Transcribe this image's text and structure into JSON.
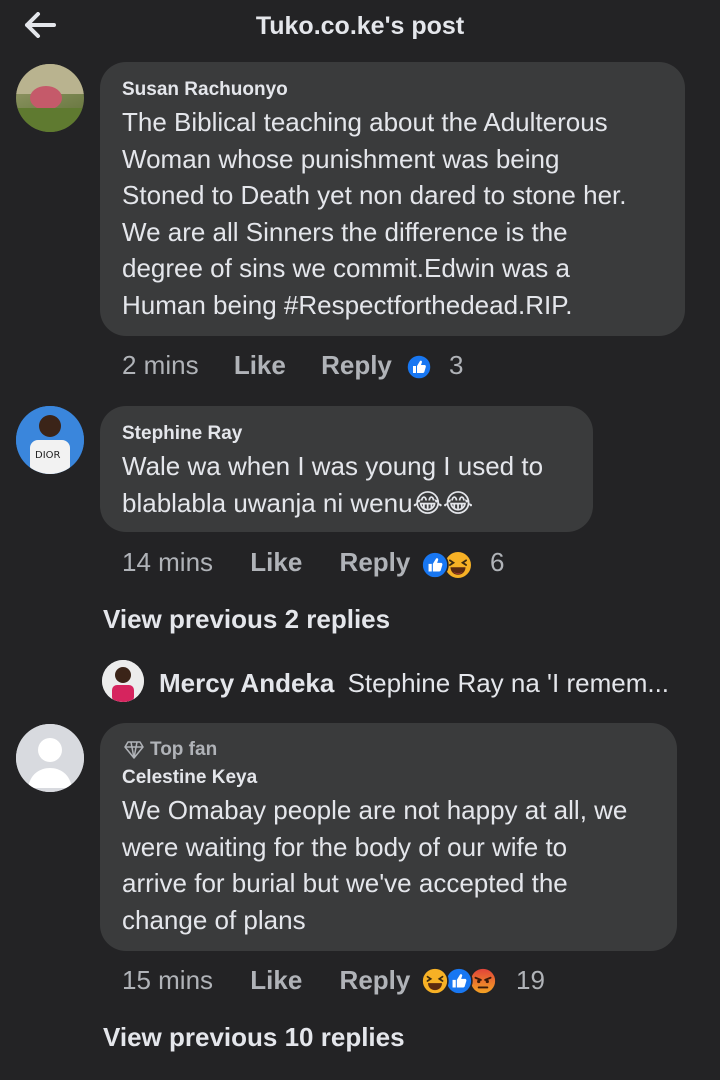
{
  "header": {
    "title": "Tuko.co.ke's post"
  },
  "comments": [
    {
      "author": "Susan Rachuonyo",
      "text": "The Biblical teaching about the Adulterous\nWoman whose punishment was being\nStoned to Death yet non dared to stone her.\nWe are all Sinners the difference is the\ndegree of sins we commit.Edwin was a\nHuman being #Respectforthedead.RIP.",
      "time": "2 mins",
      "like_label": "Like",
      "reply_label": "Reply",
      "reaction_count": "3",
      "reactions": [
        "like"
      ]
    },
    {
      "author": "Stephine Ray",
      "text": "Wale wa when I was young I used to\nblablabla uwanja ni wenu😂😂",
      "time": "14 mins",
      "like_label": "Like",
      "reply_label": "Reply",
      "reaction_count": "6",
      "reactions": [
        "like",
        "haha"
      ]
    },
    {
      "badge": "Top fan",
      "author": "Celestine Keya",
      "text": "We Omabay people are not happy at all, we\nwere waiting for the body of our wife to\narrive for burial but we've accepted the\nchange of plans",
      "time": "15 mins",
      "like_label": "Like",
      "reply_label": "Reply",
      "reaction_count": "19",
      "reactions": [
        "haha",
        "like",
        "angry"
      ]
    }
  ],
  "view_previous_1": "View previous 2 replies",
  "reply_preview": {
    "author": "Mercy Andeka",
    "text": "Stephine Ray na 'I remem..."
  },
  "view_previous_2": "View previous 10 replies",
  "colors": {
    "background": "#232325",
    "bubble": "#3a3b3c",
    "like_blue": "#1877f2",
    "haha_yellow": "#f7b125",
    "angry_orange": "#e9710f"
  }
}
